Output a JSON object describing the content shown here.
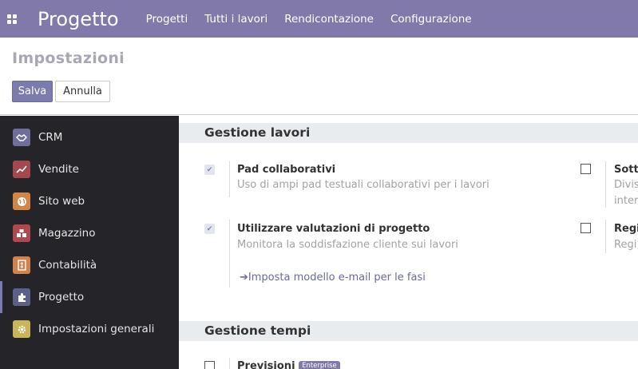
{
  "topbar": {
    "apps_icon": "grid-icon",
    "brand": "Progetto",
    "menu": [
      "Progetti",
      "Tutti i lavori",
      "Rendicontazione",
      "Configurazione"
    ]
  },
  "control": {
    "title": "Impostazioni",
    "save_label": "Salva",
    "cancel_label": "Annulla"
  },
  "sidebar": {
    "items": [
      {
        "label": "CRM",
        "icon": "handshake-icon",
        "color": "#6f6d9a"
      },
      {
        "label": "Vendite",
        "icon": "chart-icon",
        "color": "#a3484d"
      },
      {
        "label": "Sito web",
        "icon": "globe-icon",
        "color": "#d28547"
      },
      {
        "label": "Magazzino",
        "icon": "boxes-icon",
        "color": "#b2484f"
      },
      {
        "label": "Contabilità",
        "icon": "invoice-icon",
        "color": "#d1824d"
      },
      {
        "label": "Progetto",
        "icon": "puzzle-icon",
        "color": "#5d5f87"
      },
      {
        "label": "Impostazioni generali",
        "icon": "gear-icon",
        "color": "#c9b459"
      }
    ],
    "active": "Progetto"
  },
  "sections": {
    "gestione_lavori": {
      "title": "Gestione lavori",
      "options": {
        "pad": {
          "title": "Pad collaborativi",
          "desc": "Uso di ampi pad testuali collaborativi per i lavori",
          "checked": true
        },
        "rating": {
          "title": "Utilizzare valutazioni di progetto",
          "desc": "Monitora la soddisfazione cliente sui lavori",
          "checked": true,
          "link": "Imposta modello e-mail per le fasi"
        },
        "right1": {
          "title": "Sott",
          "desc1": "Divis",
          "desc2": "inter",
          "checked": false
        },
        "right2": {
          "title": "Regi",
          "desc": "Regi",
          "checked": false
        }
      }
    },
    "gestione_tempi": {
      "title": "Gestione tempi",
      "options": {
        "forecast": {
          "title": "Previsioni",
          "badge": "Enterprise",
          "checked": false
        }
      }
    }
  },
  "colors": {
    "brand": "#8279ab",
    "primary_button": "#7c7bad",
    "sidebar_bg": "#252529"
  }
}
